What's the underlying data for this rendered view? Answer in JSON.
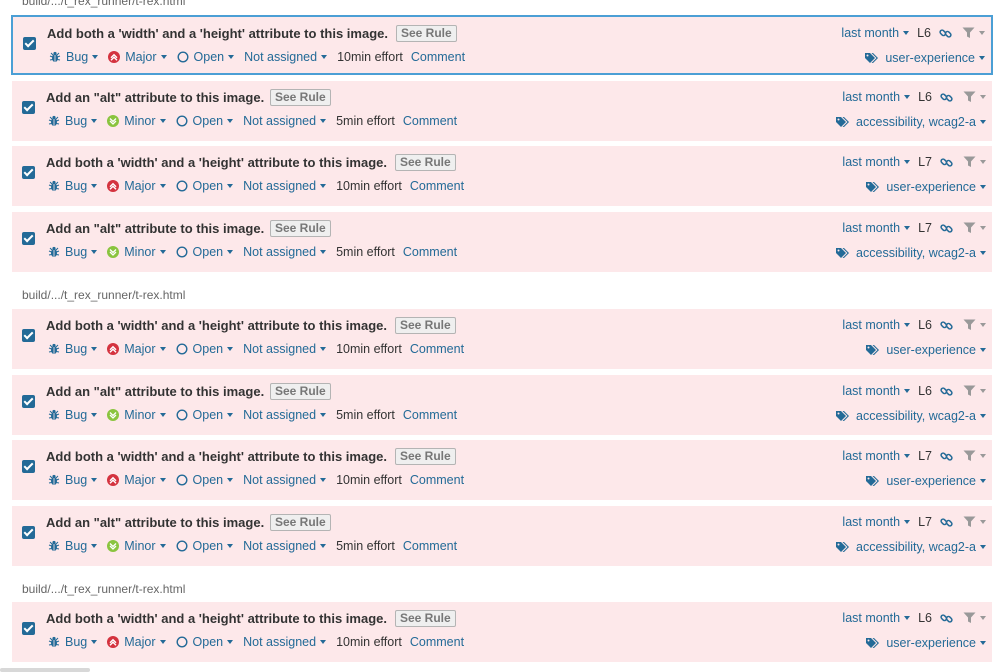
{
  "colors": {
    "issue_bg": "#fde8ea",
    "link": "#236a97",
    "major": "#d4333f",
    "minor": "#8ac43f",
    "selected_border": "#4b9fd5"
  },
  "groups": [
    {
      "component": "build/.../t_rex_runner/t-rex.html",
      "issues": [
        {
          "message": "Add both a 'width' and a 'height' attribute to this image.",
          "see_rule": "See Rule",
          "type": "Bug",
          "severity": "Major",
          "status": "Open",
          "assignee": "Not assigned",
          "effort": "10min effort",
          "comment": "Comment",
          "date": "last month",
          "line": "L6",
          "tags": "user-experience",
          "selected": true
        },
        {
          "message": "Add an \"alt\" attribute to this image.",
          "see_rule": "See Rule",
          "type": "Bug",
          "severity": "Minor",
          "status": "Open",
          "assignee": "Not assigned",
          "effort": "5min effort",
          "comment": "Comment",
          "date": "last month",
          "line": "L6",
          "tags": "accessibility, wcag2-a",
          "selected": false
        },
        {
          "message": "Add both a 'width' and a 'height' attribute to this image.",
          "see_rule": "See Rule",
          "type": "Bug",
          "severity": "Major",
          "status": "Open",
          "assignee": "Not assigned",
          "effort": "10min effort",
          "comment": "Comment",
          "date": "last month",
          "line": "L7",
          "tags": "user-experience",
          "selected": false
        },
        {
          "message": "Add an \"alt\" attribute to this image.",
          "see_rule": "See Rule",
          "type": "Bug",
          "severity": "Minor",
          "status": "Open",
          "assignee": "Not assigned",
          "effort": "5min effort",
          "comment": "Comment",
          "date": "last month",
          "line": "L7",
          "tags": "accessibility, wcag2-a",
          "selected": false
        }
      ]
    },
    {
      "component": "build/.../t_rex_runner/t-rex.html",
      "issues": [
        {
          "message": "Add both a 'width' and a 'height' attribute to this image.",
          "see_rule": "See Rule",
          "type": "Bug",
          "severity": "Major",
          "status": "Open",
          "assignee": "Not assigned",
          "effort": "10min effort",
          "comment": "Comment",
          "date": "last month",
          "line": "L6",
          "tags": "user-experience",
          "selected": false
        },
        {
          "message": "Add an \"alt\" attribute to this image.",
          "see_rule": "See Rule",
          "type": "Bug",
          "severity": "Minor",
          "status": "Open",
          "assignee": "Not assigned",
          "effort": "5min effort",
          "comment": "Comment",
          "date": "last month",
          "line": "L6",
          "tags": "accessibility, wcag2-a",
          "selected": false
        },
        {
          "message": "Add both a 'width' and a 'height' attribute to this image.",
          "see_rule": "See Rule",
          "type": "Bug",
          "severity": "Major",
          "status": "Open",
          "assignee": "Not assigned",
          "effort": "10min effort",
          "comment": "Comment",
          "date": "last month",
          "line": "L7",
          "tags": "user-experience",
          "selected": false
        },
        {
          "message": "Add an \"alt\" attribute to this image.",
          "see_rule": "See Rule",
          "type": "Bug",
          "severity": "Minor",
          "status": "Open",
          "assignee": "Not assigned",
          "effort": "5min effort",
          "comment": "Comment",
          "date": "last month",
          "line": "L7",
          "tags": "accessibility, wcag2-a",
          "selected": false
        }
      ]
    },
    {
      "component": "build/.../t_rex_runner/t-rex.html",
      "issues": [
        {
          "message": "Add both a 'width' and a 'height' attribute to this image.",
          "see_rule": "See Rule",
          "type": "Bug",
          "severity": "Major",
          "status": "Open",
          "assignee": "Not assigned",
          "effort": "10min effort",
          "comment": "Comment",
          "date": "last month",
          "line": "L6",
          "tags": "user-experience",
          "selected": false
        }
      ]
    }
  ]
}
